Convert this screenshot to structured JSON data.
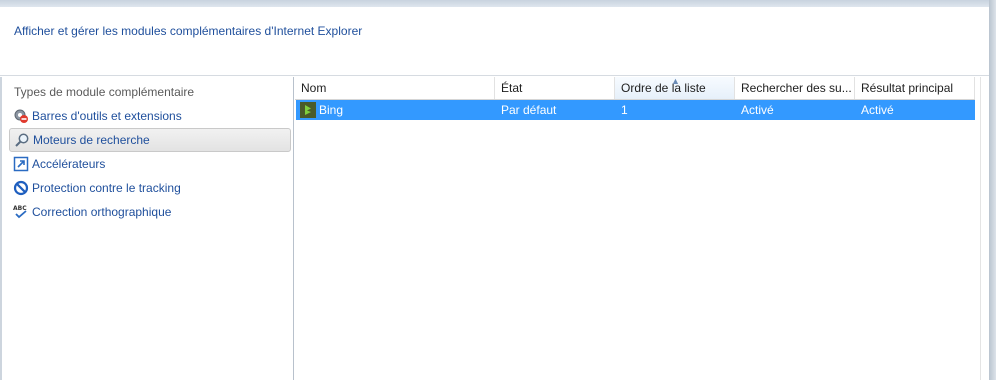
{
  "header": {
    "title": "Afficher et gérer les modules complémentaires d'Internet Explorer"
  },
  "sidebar": {
    "heading": "Types de module complémentaire",
    "items": [
      {
        "label": "Barres d'outils et extensions",
        "icon": "gear-block-icon"
      },
      {
        "label": "Moteurs de recherche",
        "icon": "search-icon",
        "selected": true
      },
      {
        "label": "Accélérateurs",
        "icon": "accelerator-icon"
      },
      {
        "label": "Protection contre le tracking",
        "icon": "no-entry-icon"
      },
      {
        "label": "Correction orthographique",
        "icon": "spellcheck-icon"
      }
    ]
  },
  "grid": {
    "columns": [
      "Nom",
      "État",
      "Ordre de la liste",
      "Rechercher des su...",
      "Résultat principal"
    ],
    "sorted_column": "Ordre de la liste",
    "rows": [
      {
        "name": "Bing",
        "state": "Par défaut",
        "order": "1",
        "suggestions": "Activé",
        "top_result": "Activé",
        "selected": true
      }
    ]
  },
  "colors": {
    "selection": "#3399ff",
    "link": "#1f4f9c"
  }
}
